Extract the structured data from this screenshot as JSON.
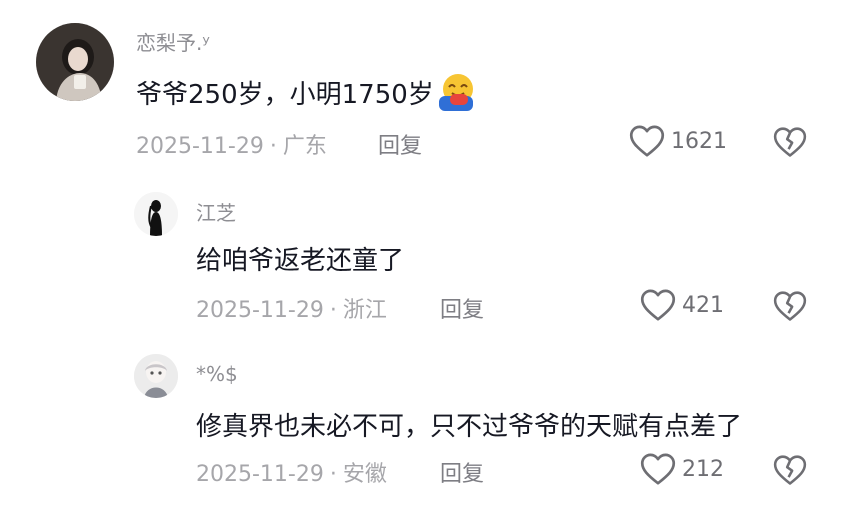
{
  "comments": [
    {
      "username": "恋梨予.ʸ",
      "text": "爷爷250岁，小明1750岁",
      "emoji": "hugging-face-emoji",
      "date": "2025-11-29",
      "location": "广东",
      "reply_label": "回复",
      "likes": "1621"
    },
    {
      "username": "江芝",
      "text": "给咱爷返老还童了",
      "date": "2025-11-29",
      "location": "浙江",
      "reply_label": "回复",
      "likes": "421"
    },
    {
      "username": "*%$",
      "text": "修真界也未必不可，只不过爷爷的天赋有点差了",
      "date": "2025-11-29",
      "location": "安徽",
      "reply_label": "回复",
      "likes": "212"
    }
  ],
  "icons": {
    "like": "heart-outline-icon",
    "dislike": "broken-heart-icon"
  },
  "separator": "·"
}
